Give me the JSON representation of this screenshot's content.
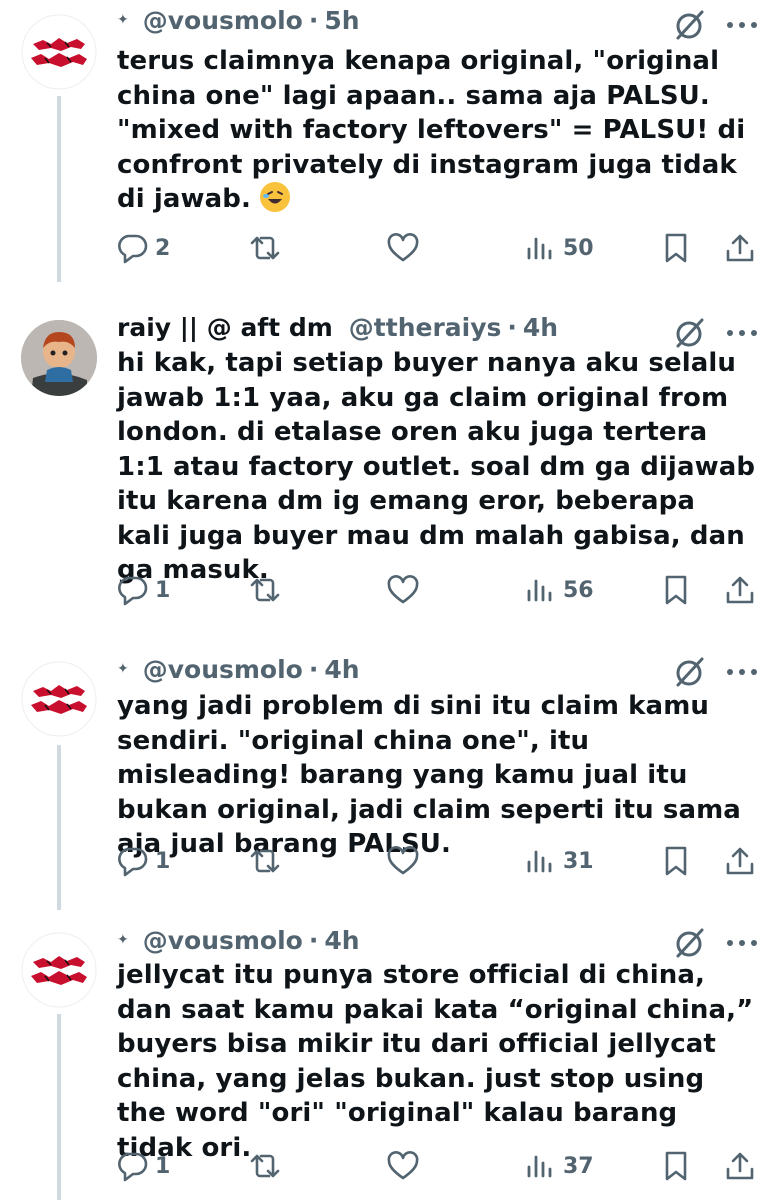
{
  "tweets": [
    {
      "display_name": "",
      "handle": "@vousmolo",
      "separator": "·",
      "time": "5h",
      "text": "terus claimnya kenapa original, \"original china one\" lagi apaan.. sama aja PALSU. \"mixed with factory leftovers\" = PALSU! di confront privately di instagram juga tidak di jawab.",
      "emoji": "rolling-on-floor-laughing",
      "replies": "2",
      "reposts": "",
      "views": "50",
      "avatar_text": "VOUS MOLO"
    },
    {
      "display_name": "raiy || @ aft dm",
      "handle": "@ttheraiys",
      "separator": "·",
      "time": "4h",
      "text": "hi kak, tapi setiap buyer nanya aku selalu jawab 1:1 yaa, aku ga claim original from london. di etalase oren aku juga tertera 1:1 atau factory outlet. soal dm ga dijawab itu karena dm ig emang eror, beberapa kali juga buyer mau dm malah gabisa, dan ga masuk.",
      "replies": "1",
      "reposts": "",
      "views": "56"
    },
    {
      "display_name": "",
      "handle": "@vousmolo",
      "separator": "·",
      "time": "4h",
      "text": "yang jadi problem di sini itu claim kamu sendiri. \"original china one\", itu misleading! barang yang kamu jual itu bukan original, jadi claim seperti itu sama aja jual barang PALSU.",
      "replies": "1",
      "reposts": "",
      "views": "31",
      "avatar_text": "VOUS MOLO"
    },
    {
      "display_name": "",
      "handle": "@vousmolo",
      "separator": "·",
      "time": "4h",
      "text": "jellycat itu punya store official di china, dan saat kamu pakai kata “original china,” buyers bisa mikir itu dari official jellycat china, yang jelas bukan. just stop using the word \"ori\" \"original\" kalau barang tidak ori.",
      "replies": "1",
      "reposts": "",
      "views": "37",
      "avatar_text": "VOUS MOLO"
    }
  ],
  "colors": {
    "text": "#0f1419",
    "muted": "#536471",
    "thread_line": "#cfd9de",
    "logo_red": "#c8102e"
  }
}
